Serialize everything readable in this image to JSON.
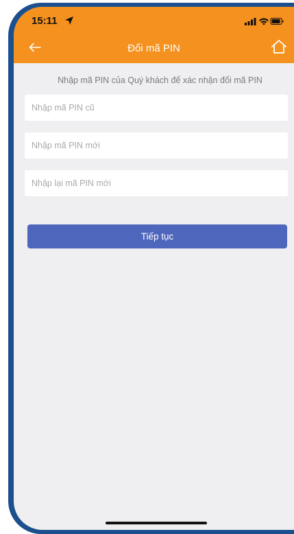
{
  "status_bar": {
    "time": "15:11",
    "location_icon": "location-arrow-icon",
    "icons": [
      "signal-icon",
      "wifi-icon",
      "battery-icon"
    ]
  },
  "nav": {
    "title": "Đổi mã PIN",
    "back_icon": "arrow-left-icon",
    "home_icon": "home-icon"
  },
  "form": {
    "instruction": "Nhập mã PIN của Quý khách để xác nhận đổi mã PIN",
    "old_pin": {
      "value": "",
      "placeholder": "Nhập mã PIN cũ"
    },
    "new_pin": {
      "value": "",
      "placeholder": "Nhập mã PIN mới"
    },
    "confirm_pin": {
      "value": "",
      "placeholder": "Nhập lại mã PIN mới"
    },
    "continue_label": "Tiếp tục"
  },
  "colors": {
    "header": "#f5911e",
    "background": "#efeff1",
    "button": "#4f66bd",
    "frame": "#1b4f8e"
  }
}
